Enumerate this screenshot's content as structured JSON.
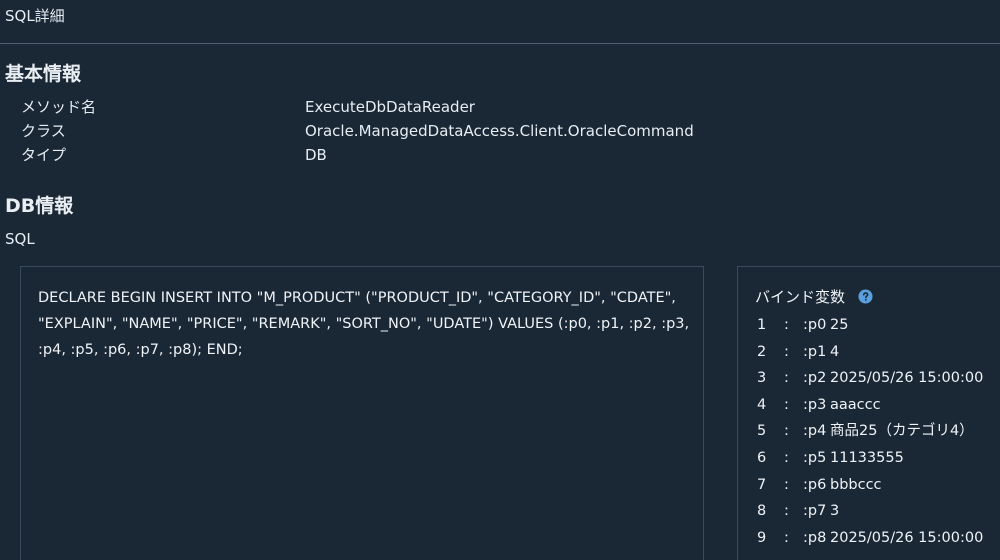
{
  "page_title": "SQL詳細",
  "basic_info": {
    "heading": "基本情報",
    "rows": [
      {
        "label": "メソッド名",
        "value": "ExecuteDbDataReader"
      },
      {
        "label": "クラス",
        "value": "Oracle.ManagedDataAccess.Client.OracleCommand"
      },
      {
        "label": "タイプ",
        "value": "DB"
      }
    ]
  },
  "db_info": {
    "heading": "DB情報",
    "sql_label": "SQL",
    "sql_text": "DECLARE BEGIN INSERT INTO \"M_PRODUCT\" (\"PRODUCT_ID\", \"CATEGORY_ID\", \"CDATE\", \"EXPLAIN\", \"NAME\", \"PRICE\", \"REMARK\", \"SORT_NO\", \"UDATE\") VALUES (:p0, :p1, :p2, :p3, :p4, :p5, :p6, :p7, :p8); END;"
  },
  "bind_variables": {
    "heading": "バインド変数",
    "help_icon": "question-circle-icon",
    "items": [
      {
        "index": "1",
        "colon": ":",
        "name": ":p0",
        "value": "25"
      },
      {
        "index": "2",
        "colon": ":",
        "name": ":p1",
        "value": "4"
      },
      {
        "index": "3",
        "colon": ":",
        "name": ":p2",
        "value": "2025/05/26 15:00:00"
      },
      {
        "index": "4",
        "colon": ":",
        "name": ":p3",
        "value": "aaaccc"
      },
      {
        "index": "5",
        "colon": ":",
        "name": ":p4",
        "value": "商品25（カテゴリ4）"
      },
      {
        "index": "6",
        "colon": ":",
        "name": ":p5",
        "value": "11133555"
      },
      {
        "index": "7",
        "colon": ":",
        "name": ":p6",
        "value": "bbbccc"
      },
      {
        "index": "8",
        "colon": ":",
        "name": ":p7",
        "value": "3"
      },
      {
        "index": "9",
        "colon": ":",
        "name": ":p8",
        "value": "2025/05/26 15:00:00"
      }
    ]
  },
  "colors": {
    "background": "#1a2734",
    "text": "#e6edf3",
    "border": "#394b5c",
    "accent": "#5aa0df"
  }
}
